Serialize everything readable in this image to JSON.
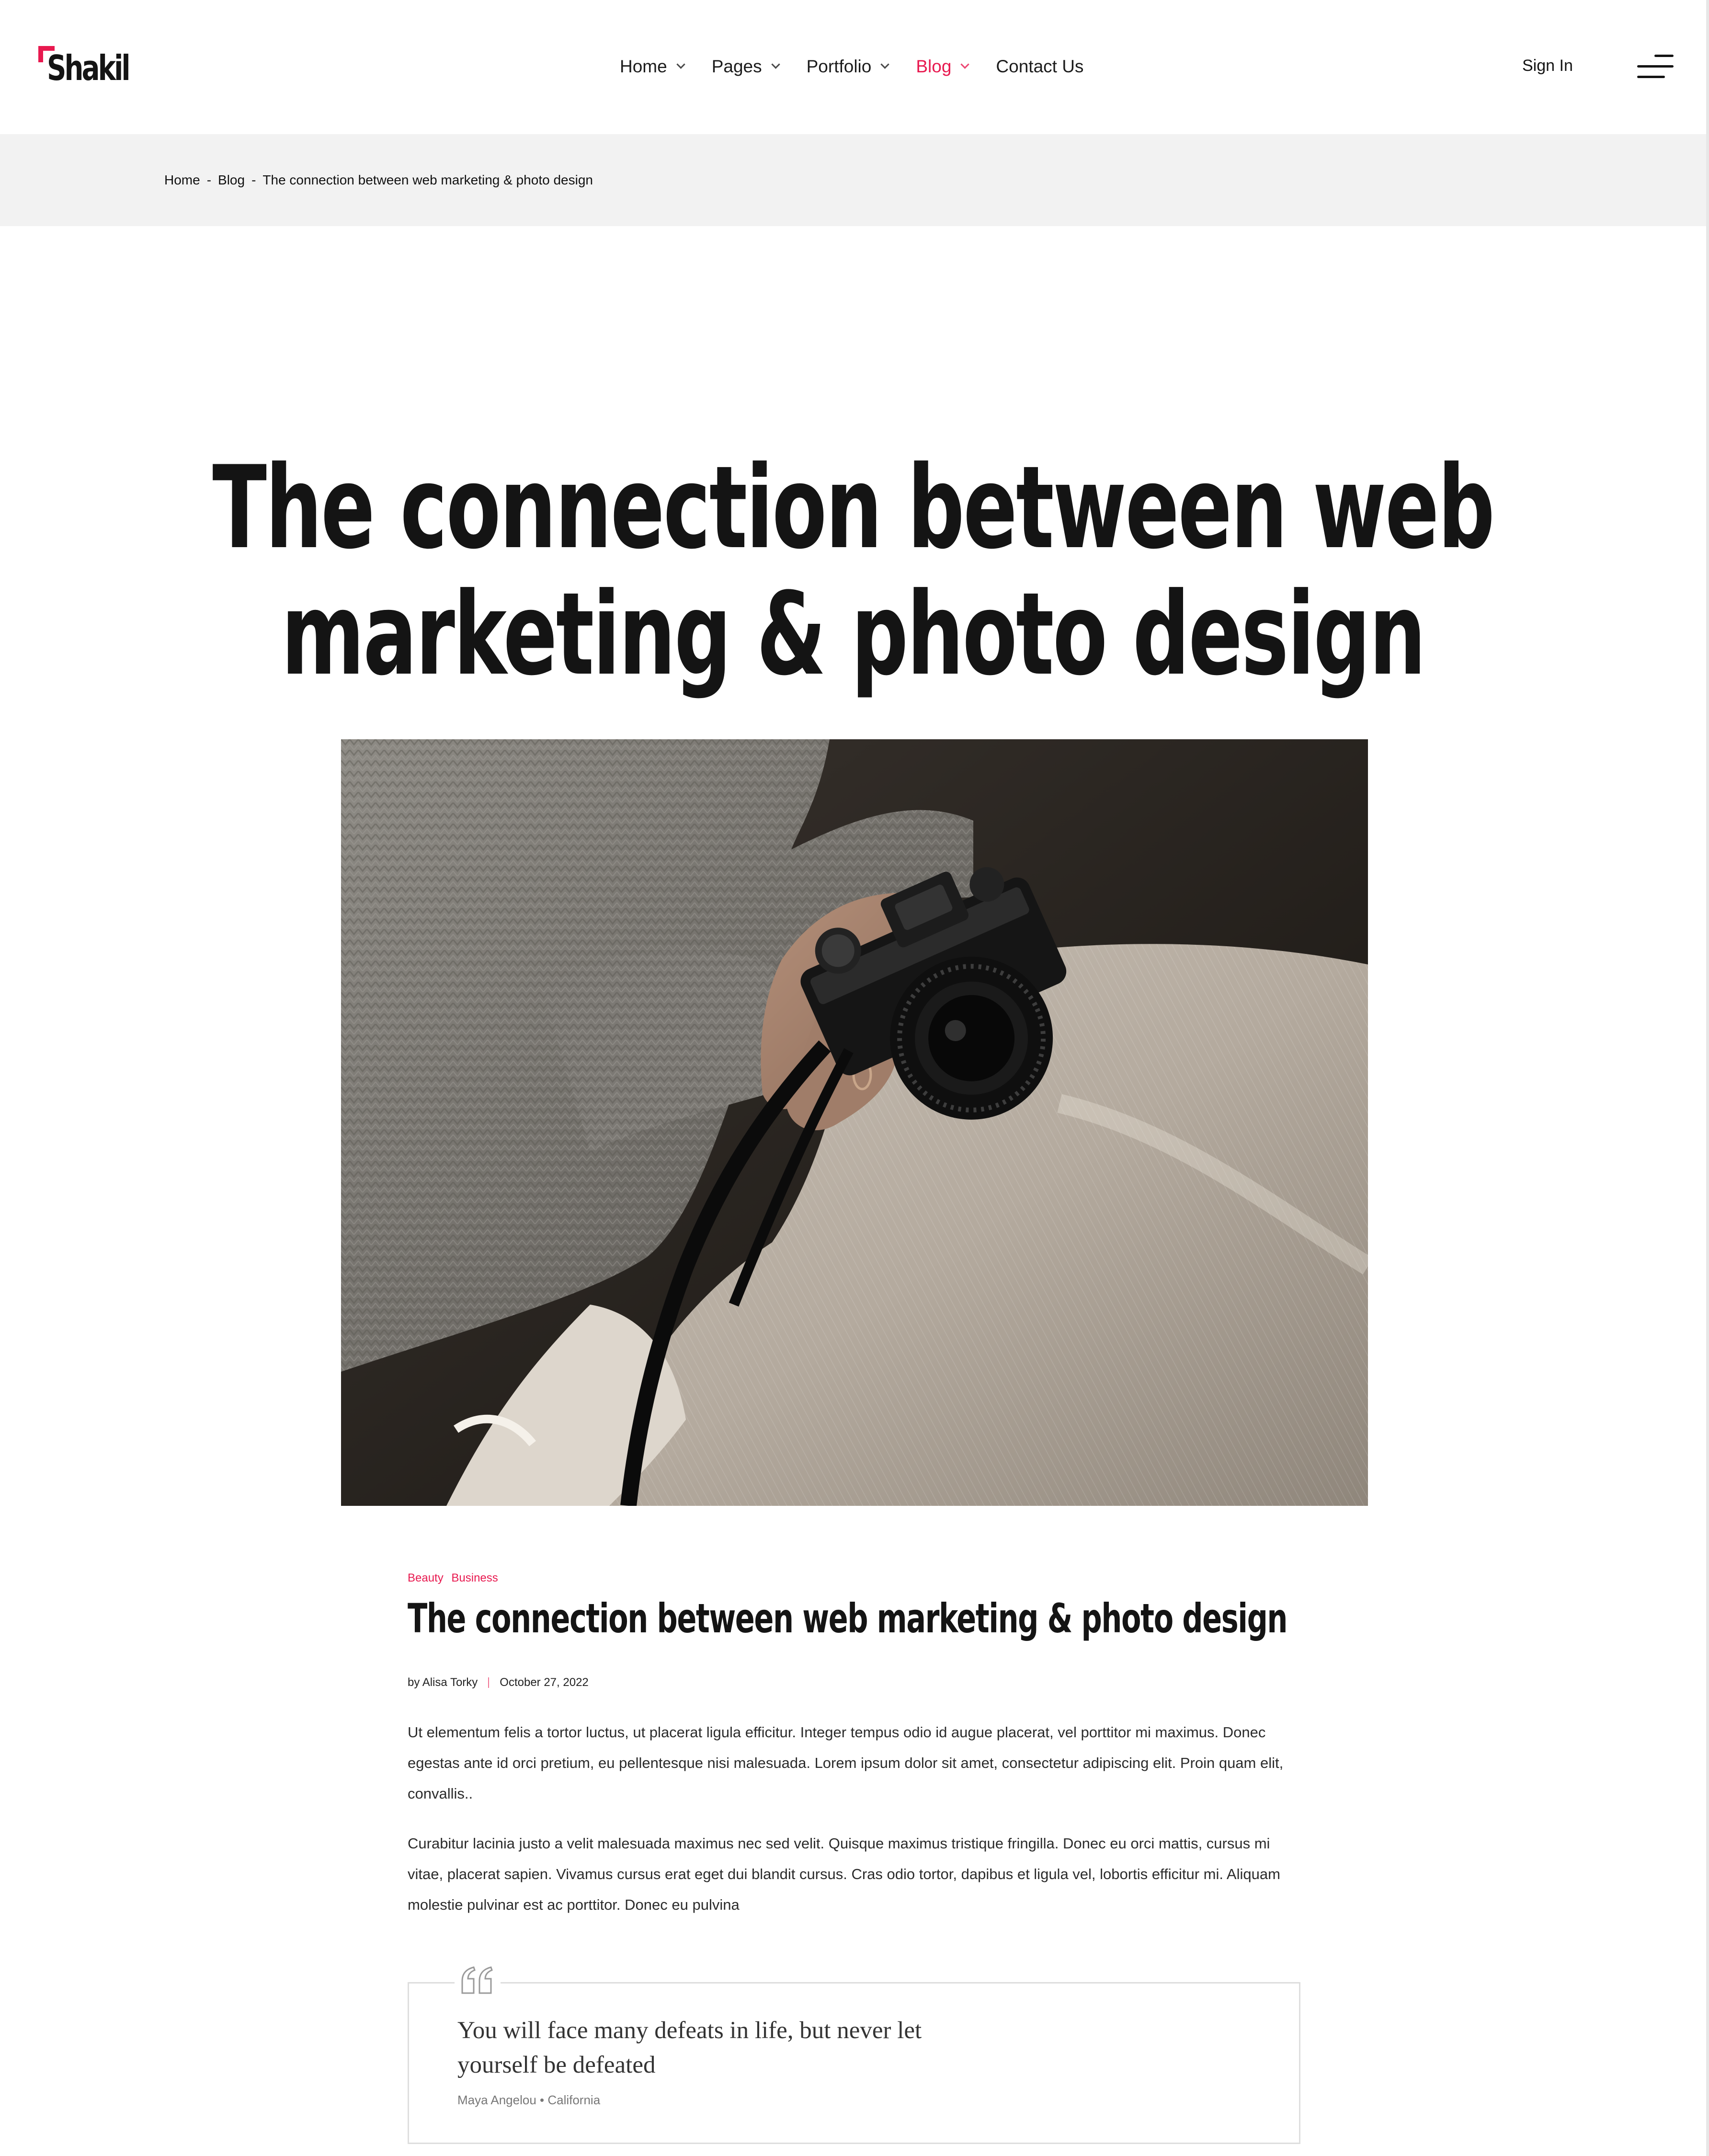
{
  "header": {
    "logo_text": "Shakil",
    "nav": [
      {
        "label": "Home",
        "has_dropdown": true,
        "active": false
      },
      {
        "label": "Pages",
        "has_dropdown": true,
        "active": false
      },
      {
        "label": "Portfolio",
        "has_dropdown": true,
        "active": false
      },
      {
        "label": "Blog",
        "has_dropdown": true,
        "active": true
      },
      {
        "label": "Contact Us",
        "has_dropdown": false,
        "active": false
      }
    ],
    "sign_in": "Sign In",
    "menu_icon": "hamburger-menu-icon"
  },
  "breadcrumb": {
    "items": [
      "Home",
      "Blog",
      "The connection between web marketing & photo design"
    ],
    "separator": "-"
  },
  "hero": {
    "title_line1": "The connection between web",
    "title_line2": "marketing & photo design"
  },
  "featured_image": {
    "alt": "Hands holding a black film camera",
    "icon": "photo-camera-image"
  },
  "article": {
    "categories": [
      "Beauty",
      "Business"
    ],
    "title": "The connection between web marketing & photo design",
    "author": "by Alisa Torky",
    "date": "October 27, 2022",
    "paragraphs": [
      "Ut elementum felis a tortor luctus, ut placerat ligula efficitur. Integer tempus odio id augue placerat, vel porttitor mi maximus. Donec egestas ante id orci pretium, eu pellentesque nisi malesuada. Lorem ipsum dolor sit amet, consectetur adipiscing elit. Proin quam elit, convallis..",
      "Curabitur lacinia justo a velit malesuada maximus nec sed velit. Quisque maximus tristique fringilla. Donec eu orci mattis, cursus mi vitae, placerat sapien. Vivamus cursus erat eget dui blandit cursus. Cras odio tortor, dapibus et ligula vel, lobortis efficitur mi. Aliquam molestie pulvinar est ac porttitor. Donec eu pulvina"
    ],
    "quote": {
      "text": "You will face many defeats in life, but never let yourself be defeated",
      "citation": "Maya Angelou • California"
    }
  },
  "colors": {
    "accent": "#e8194f",
    "text": "#141414",
    "breadcrumb_bg": "#f2f2f2"
  }
}
